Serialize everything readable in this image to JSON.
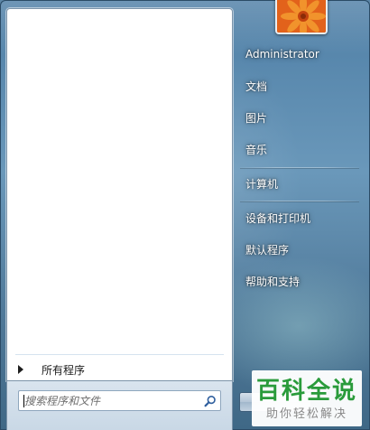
{
  "start_menu": {
    "all_programs_label": "所有程序",
    "search": {
      "placeholder": "搜索程序和文件",
      "icon": "magnifier-icon"
    },
    "user_picture": {
      "icon": "orange-flower-picture"
    },
    "right_items": [
      {
        "id": "user",
        "label": "Administrator"
      },
      {
        "id": "documents",
        "label": "文档"
      },
      {
        "id": "pictures",
        "label": "图片"
      },
      {
        "id": "music",
        "label": "音乐"
      },
      {
        "id": "computer",
        "label": "计算机"
      },
      {
        "id": "devices",
        "label": "设备和打印机"
      },
      {
        "id": "default_programs",
        "label": "默认程序"
      },
      {
        "id": "help",
        "label": "帮助和支持"
      }
    ]
  },
  "watermark": {
    "title": "百科全说",
    "subtitle": "助你轻松解决",
    "color": "#2a9b3b"
  }
}
